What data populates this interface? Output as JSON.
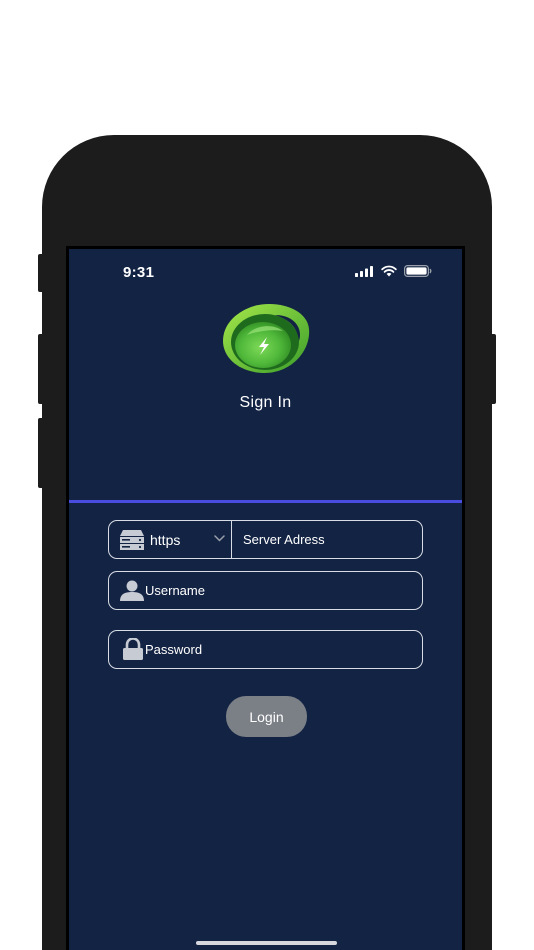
{
  "status_bar": {
    "time": "9:31"
  },
  "header": {
    "title": "Sign In"
  },
  "form": {
    "protocol": {
      "selected": "https"
    },
    "server": {
      "placeholder": "Server Adress"
    },
    "username": {
      "placeholder": "Username"
    },
    "password": {
      "placeholder": "Password"
    },
    "login_label": "Login"
  },
  "colors": {
    "screen_background": "#132344",
    "divider": "#4a4ce0",
    "login_button": "#7b7f86",
    "logo_green": "#4fb83a"
  },
  "icons": {
    "server": "server-icon",
    "chevron": "chevron-down-icon",
    "user": "user-icon",
    "lock": "lock-icon",
    "signal": "signal-icon",
    "wifi": "wifi-icon",
    "battery": "battery-icon",
    "logo": "app-logo"
  }
}
